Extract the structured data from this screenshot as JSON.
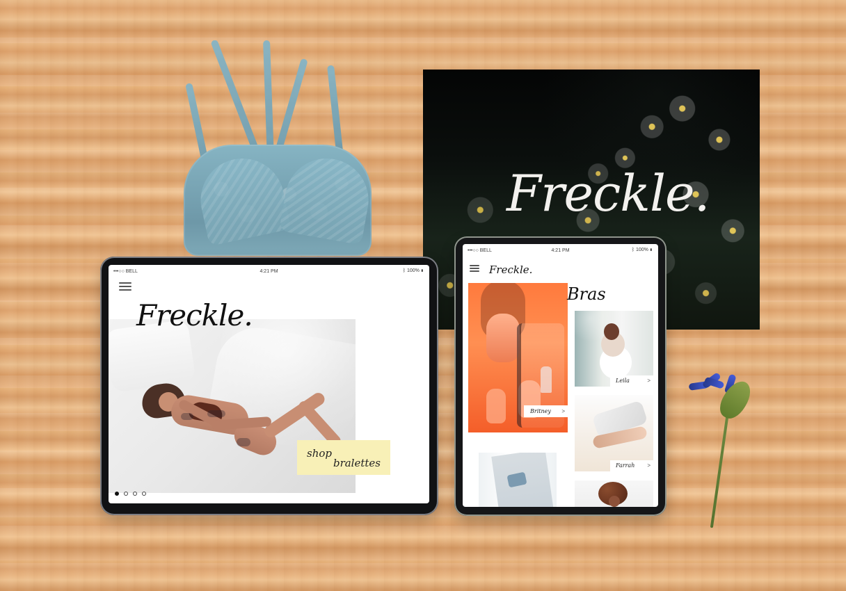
{
  "scene": {
    "poster": {
      "brand": "Freckle."
    }
  },
  "left_tablet": {
    "status": {
      "carrier": "•••○○ BELL",
      "time": "4:21 PM",
      "battery": "100%"
    },
    "brand": "Freckle.",
    "cta": {
      "line1": "shop",
      "line2": "bralettes"
    },
    "pagination": {
      "active_index": 0,
      "count": 4
    }
  },
  "right_tablet": {
    "status": {
      "carrier": "•••○○ BELL",
      "time": "4:21 PM",
      "battery": "100%"
    },
    "brand": "Freckle.",
    "section_title": "Bras",
    "products": [
      {
        "name": "Britney",
        "arrow": ">"
      },
      {
        "name": "Leila",
        "arrow": ">"
      },
      {
        "name": "Farrah",
        "arrow": ">"
      }
    ]
  },
  "icons": {
    "menu": "menu-icon",
    "wifi": "wifi-icon",
    "battery": "battery-icon",
    "bluetooth": "bluetooth-icon",
    "chevron": "chevron-right-icon"
  },
  "colors": {
    "cta_bg": "#f8f0b7",
    "poster_text": "#f3f1ee",
    "dark_device": "#111214",
    "brand_text": "#111111"
  }
}
